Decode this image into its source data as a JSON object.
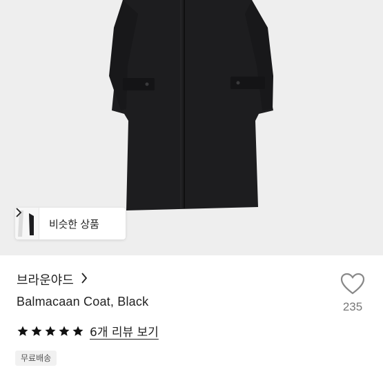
{
  "product": {
    "brand": "브라운야드",
    "name": "Balmacaan Coat, Black",
    "rating_stars": 5,
    "review_link": "6개 리뷰 보기",
    "badge": "무료배송",
    "like_count": "235"
  },
  "similar": {
    "label": "비슷한 상품"
  },
  "icons": {
    "brand_chevron": "chevron-right-icon",
    "similar_chevron": "chevron-right-icon",
    "like": "heart-icon",
    "star": "star-icon"
  },
  "colors": {
    "hero_bg": "#eeeeee",
    "coat": "#1d1d1f",
    "star": "#111111",
    "like_icon": "#888888"
  }
}
